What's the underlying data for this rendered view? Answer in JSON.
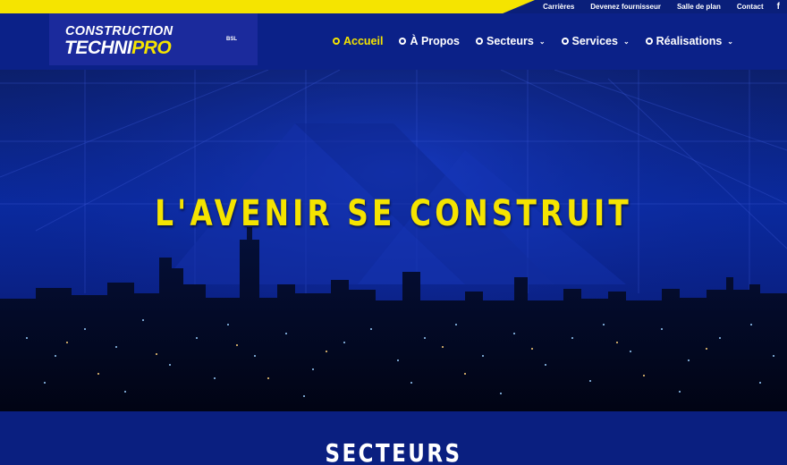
{
  "topbar": {
    "links": [
      "Carrières",
      "Devenez fournisseur",
      "Salle de plan",
      "Contact"
    ],
    "social_icon": "facebook-icon",
    "accent_color": "#f5e400"
  },
  "logo": {
    "line1": "CONSTRUCTION",
    "line2_white": "TECHNI",
    "line2_yellow": "PRO",
    "suffix": "BSL"
  },
  "nav": {
    "items": [
      {
        "label": "Accueil",
        "active": true,
        "dropdown": false
      },
      {
        "label": "À Propos",
        "active": false,
        "dropdown": false
      },
      {
        "label": "Secteurs",
        "active": false,
        "dropdown": true
      },
      {
        "label": "Services",
        "active": false,
        "dropdown": true
      },
      {
        "label": "Réalisations",
        "active": false,
        "dropdown": true
      }
    ]
  },
  "hero": {
    "title": "L'AVENIR SE CONSTRUIT"
  },
  "sectors": {
    "heading": "SECTEURS"
  },
  "colors": {
    "brand_blue": "#0b2188",
    "brand_yellow": "#f5e400"
  }
}
